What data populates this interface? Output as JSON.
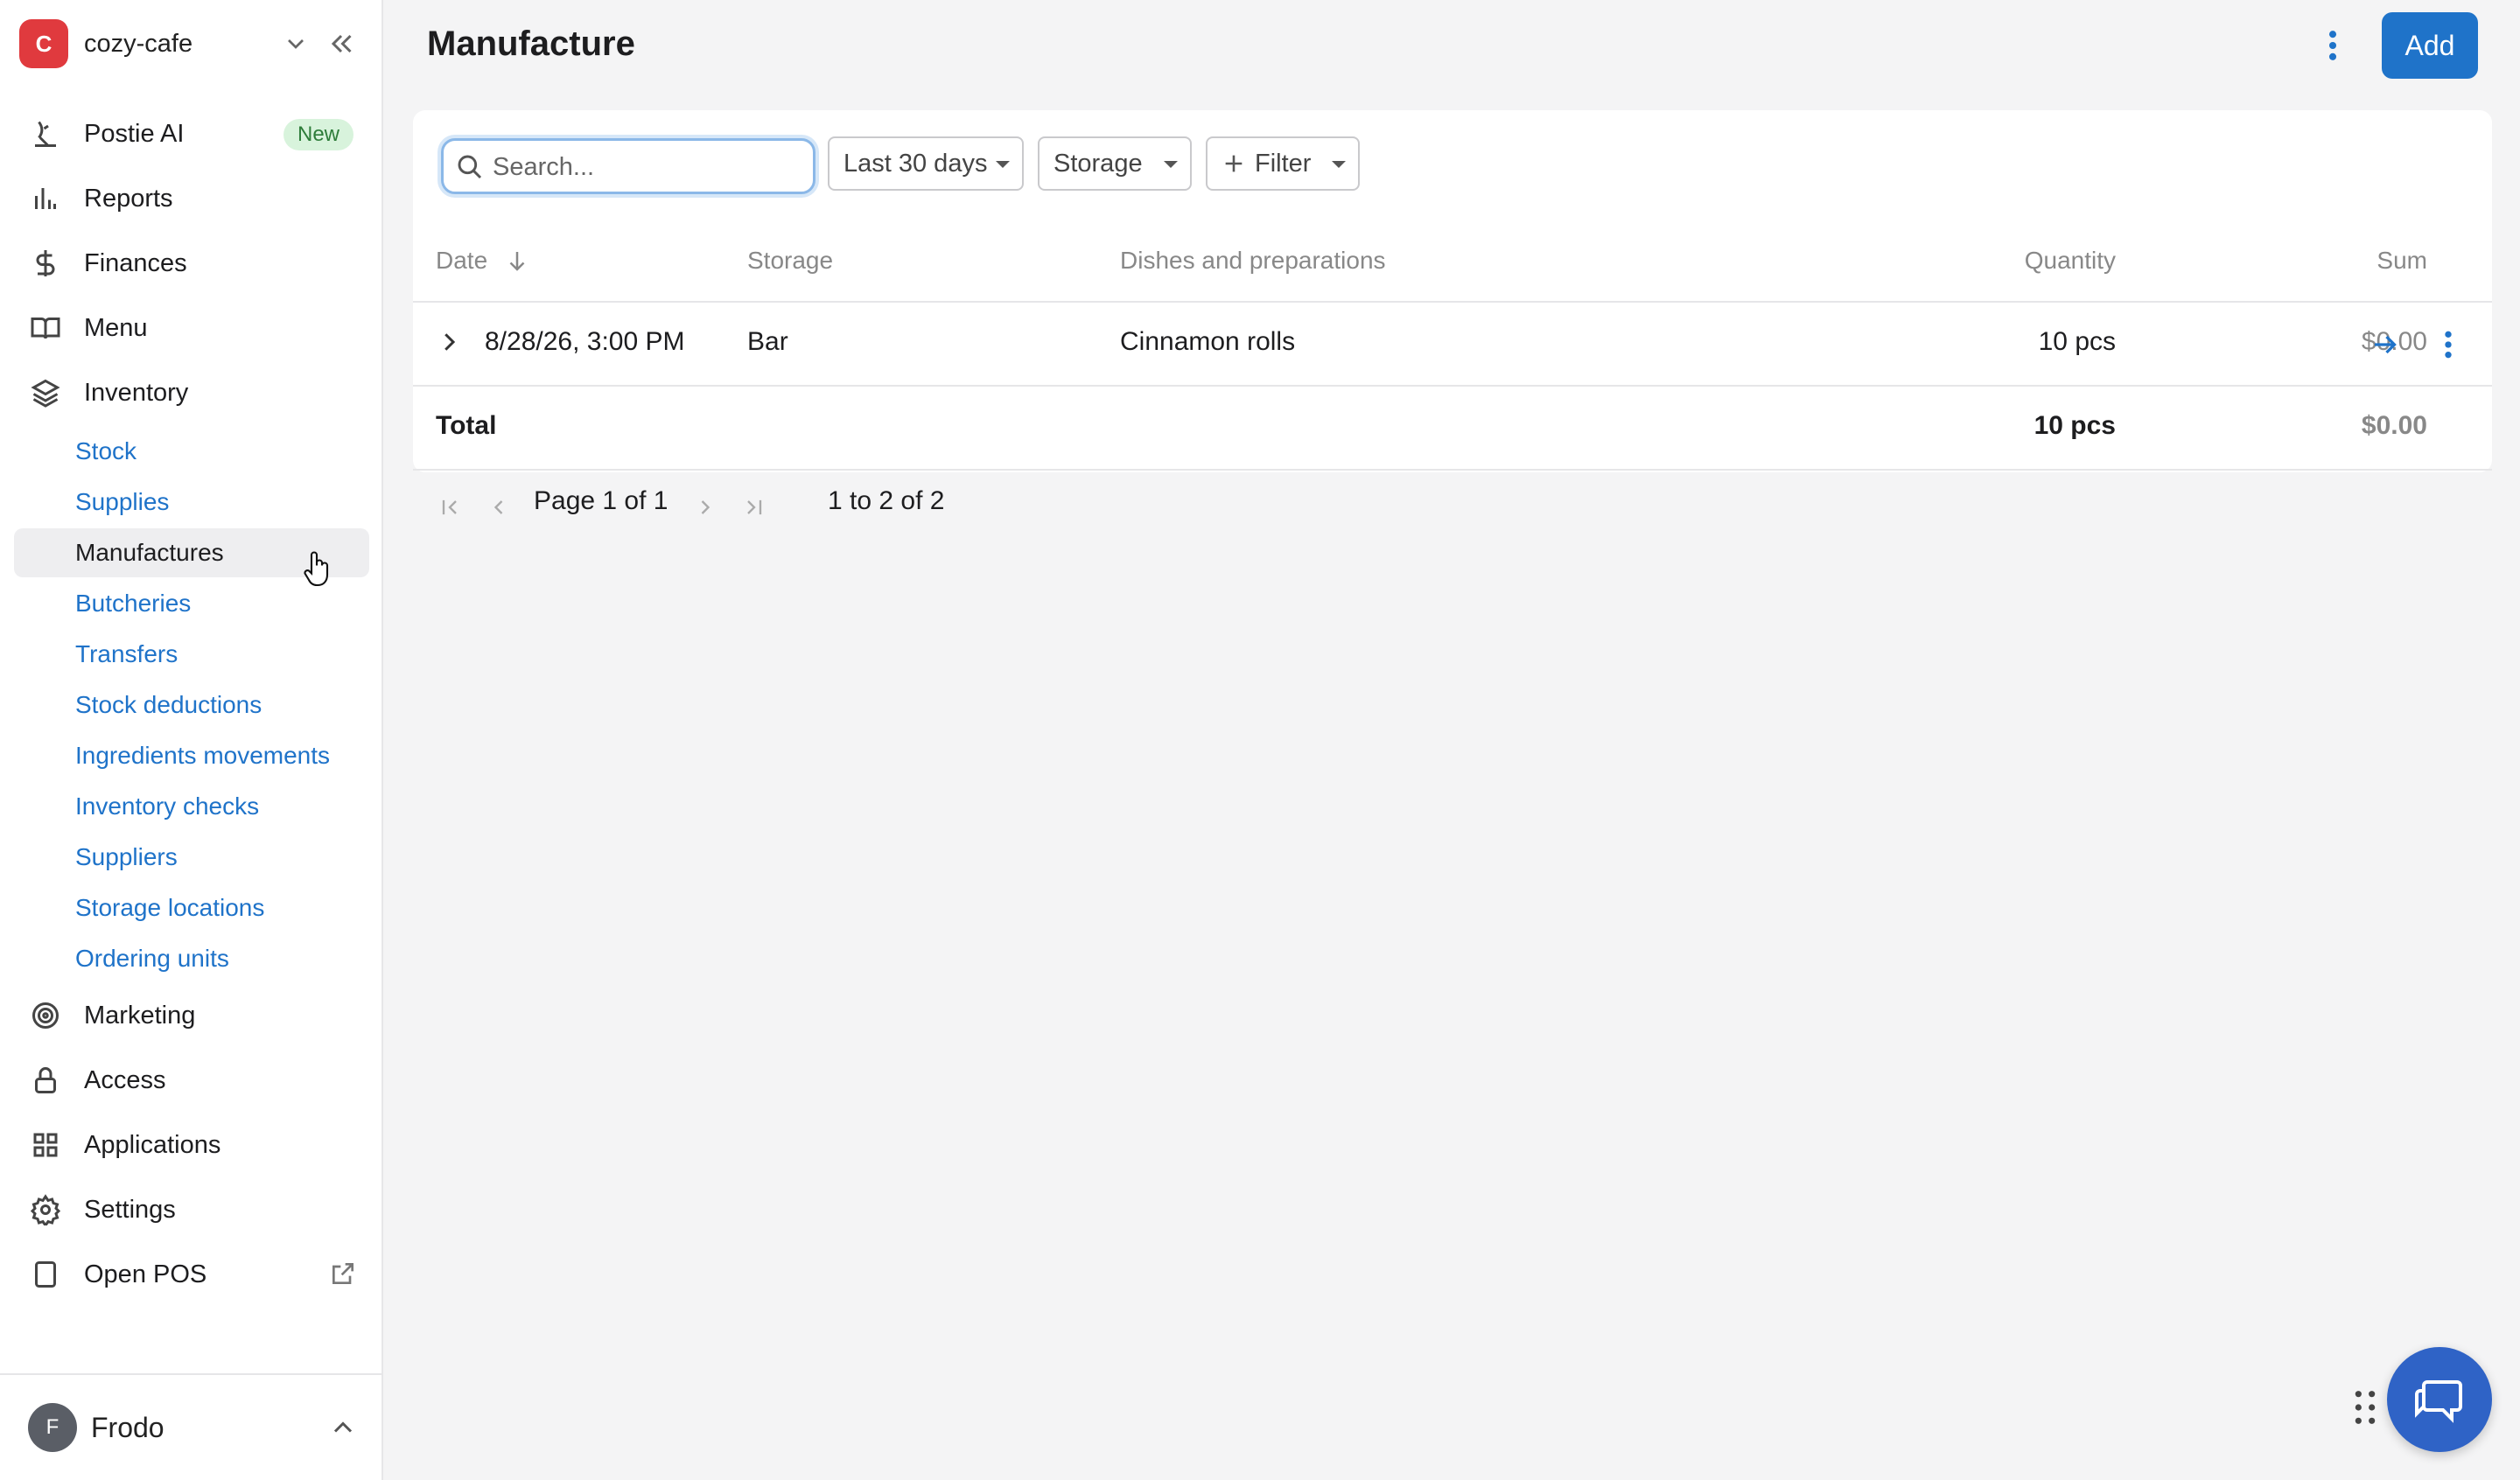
{
  "workspace": {
    "logo_letter": "C",
    "name": "cozy-cafe"
  },
  "nav": {
    "postie_ai": "Postie AI",
    "postie_badge": "New",
    "reports": "Reports",
    "finances": "Finances",
    "menu": "Menu",
    "inventory": "Inventory",
    "marketing": "Marketing",
    "access": "Access",
    "applications": "Applications",
    "settings": "Settings",
    "open_pos": "Open POS"
  },
  "inventory_sub": [
    "Stock",
    "Supplies",
    "Manufactures",
    "Butcheries",
    "Transfers",
    "Stock deductions",
    "Ingredients movements",
    "Inventory checks",
    "Suppliers",
    "Storage locations",
    "Ordering units"
  ],
  "active_sub": "Manufactures",
  "user": {
    "initial": "F",
    "name": "Frodo"
  },
  "page": {
    "title": "Manufacture",
    "add_label": "Add"
  },
  "toolbar": {
    "search_placeholder": "Search...",
    "period": "Last 30 days",
    "storage": "Storage",
    "filter": "Filter"
  },
  "table": {
    "columns": {
      "date": "Date",
      "storage": "Storage",
      "dishes": "Dishes and preparations",
      "quantity": "Quantity",
      "sum": "Sum"
    },
    "rows": [
      {
        "date": "8/28/26, 3:00 PM",
        "storage": "Bar",
        "dishes": "Cinnamon rolls",
        "quantity": "10 pcs",
        "sum": "$0.00"
      }
    ],
    "total": {
      "label": "Total",
      "quantity": "10 pcs",
      "sum": "$0.00"
    }
  },
  "pagination": {
    "page_label": "Page 1 of 1",
    "range_label": "1 to 2 of 2"
  },
  "colors": {
    "accent": "#1f73c9",
    "brand": "#e03a3e",
    "chat": "#2f63c6"
  }
}
